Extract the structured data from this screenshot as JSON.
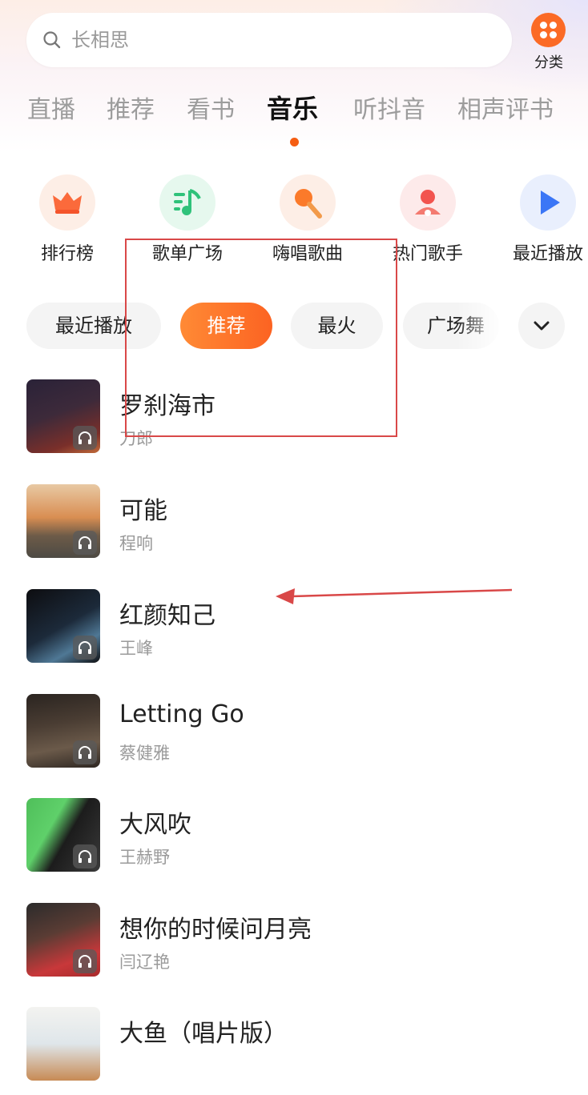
{
  "search": {
    "placeholder": "长相思",
    "category_label": "分类"
  },
  "tabs": [
    {
      "label": "直播",
      "active": false
    },
    {
      "label": "推荐",
      "active": false
    },
    {
      "label": "看书",
      "active": false
    },
    {
      "label": "音乐",
      "active": true
    },
    {
      "label": "听抖音",
      "active": false
    },
    {
      "label": "相声评书",
      "active": false
    }
  ],
  "shortcuts": [
    {
      "label": "排行榜",
      "icon": "crown-icon",
      "color": "#fb6a3b"
    },
    {
      "label": "歌单广场",
      "icon": "playlist-icon",
      "color": "#2fc27a"
    },
    {
      "label": "嗨唱歌曲",
      "icon": "microphone-icon",
      "color": "#fb7a2a"
    },
    {
      "label": "热门歌手",
      "icon": "singer-icon",
      "color": "#f2544f"
    },
    {
      "label": "最近播放",
      "icon": "play-icon",
      "color": "#3b76f6"
    }
  ],
  "chips": [
    {
      "label": "最近播放",
      "active": false
    },
    {
      "label": "推荐",
      "active": true
    },
    {
      "label": "最火",
      "active": false
    },
    {
      "label": "广场舞",
      "active": false
    }
  ],
  "songs": [
    {
      "title": "罗刹海市",
      "artist": "刀郎"
    },
    {
      "title": "可能",
      "artist": "程响"
    },
    {
      "title": "红颜知己",
      "artist": "王峰"
    },
    {
      "title": "Letting Go",
      "artist": "蔡健雅"
    },
    {
      "title": "大风吹",
      "artist": "王赫野"
    },
    {
      "title": "想你的时候问月亮",
      "artist": "闫辽艳"
    },
    {
      "title": "大鱼（唱片版）",
      "artist": ""
    }
  ],
  "colors": {
    "accent": "#fb6a25",
    "annotation": "#d94848"
  }
}
